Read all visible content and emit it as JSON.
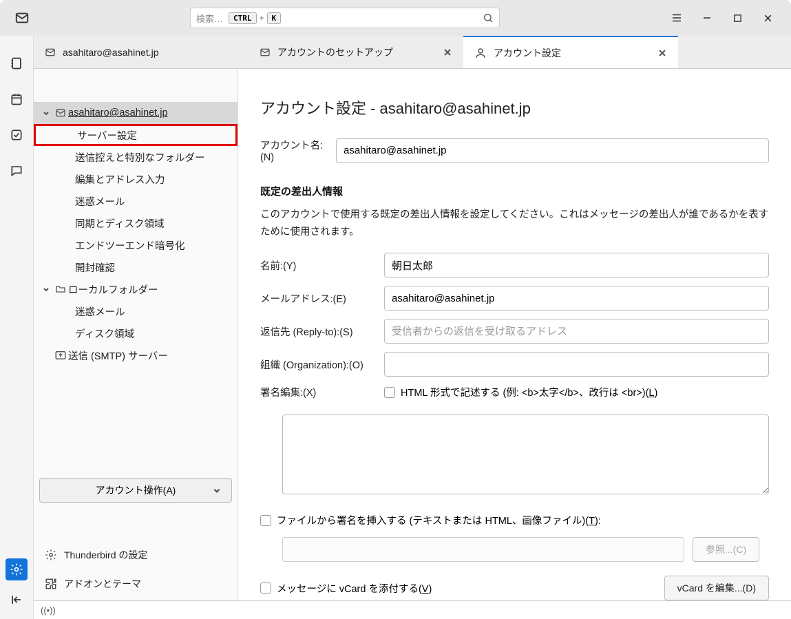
{
  "titlebar": {
    "search_placeholder": "検索…",
    "kbd1": "CTRL",
    "kbd_plus": "+",
    "kbd2": "K"
  },
  "tabs": [
    {
      "label": "asahitaro@asahinet.jp",
      "icon": "mail"
    },
    {
      "label": "アカウントのセットアップ",
      "icon": "mail",
      "closable": true
    },
    {
      "label": "アカウント設定",
      "icon": "settings-badge",
      "closable": true,
      "active": true
    }
  ],
  "sidebar": {
    "account": "asahitaro@asahinet.jp",
    "items": [
      "サーバー設定",
      "送信控えと特別なフォルダー",
      "編集とアドレス入力",
      "迷惑メール",
      "同期とディスク領域",
      "エンドツーエンド暗号化",
      "開封確認"
    ],
    "local_folders": "ローカルフォルダー",
    "local_items": [
      "迷惑メール",
      "ディスク領域"
    ],
    "smtp": "送信 (SMTP) サーバー",
    "account_ops": "アカウント操作(A)",
    "tb_settings": "Thunderbird の設定",
    "addons": "アドオンとテーマ"
  },
  "pane": {
    "title": "アカウント設定 - asahitaro@asahinet.jp",
    "account_name_label": "アカウント名:(N)",
    "account_name_value": "asahitaro@asahinet.jp",
    "identity_head": "既定の差出人情報",
    "identity_desc": "このアカウントで使用する既定の差出人情報を設定してください。これはメッセージの差出人が誰であるかを表すために使用されます。",
    "name_label": "名前:(Y)",
    "name_value": "朝日太郎",
    "email_label": "メールアドレス:(E)",
    "email_value": "asahitaro@asahinet.jp",
    "replyto_label": "返信先 (Reply-to):(S)",
    "replyto_placeholder": "受信者からの返信を受け取るアドレス",
    "org_label": "組織 (Organization):(O)",
    "sig_label": "署名編集:(X)",
    "html_check_prefix": "HTML 形式で記述する (例: <b>太字</b>、改行は <br>)(",
    "html_check_u": "L",
    "html_check_suffix": ")",
    "file_check_prefix": "ファイルから署名を挿入する (テキストまたは HTML、画像ファイル)(",
    "file_check_u": "T",
    "file_check_suffix": "):",
    "browse_btn": "参照...(C)",
    "vcard_check_prefix": "メッセージに vCard を添付する(",
    "vcard_check_u": "V",
    "vcard_check_suffix": ")",
    "vcard_btn": "vCard を編集...(D)"
  }
}
